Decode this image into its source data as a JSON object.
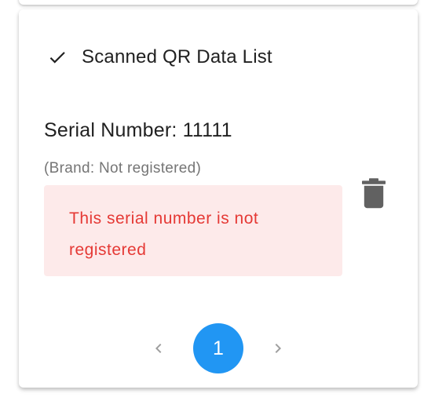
{
  "header": {
    "title": "Scanned QR Data List",
    "icon": "check-icon"
  },
  "item": {
    "serial_line": "Serial Number: 11111",
    "brand_line": "(Brand: Not registered)",
    "alert_text": "This serial number is not registered",
    "delete_icon": "trash-icon"
  },
  "pagination": {
    "current_page": "1",
    "prev_icon": "chevron-left-icon",
    "next_icon": "chevron-right-icon"
  },
  "colors": {
    "primary": "#2196f3",
    "alert_bg": "#fdeaea",
    "alert_text": "#e53935",
    "icon_gray": "#616161"
  }
}
